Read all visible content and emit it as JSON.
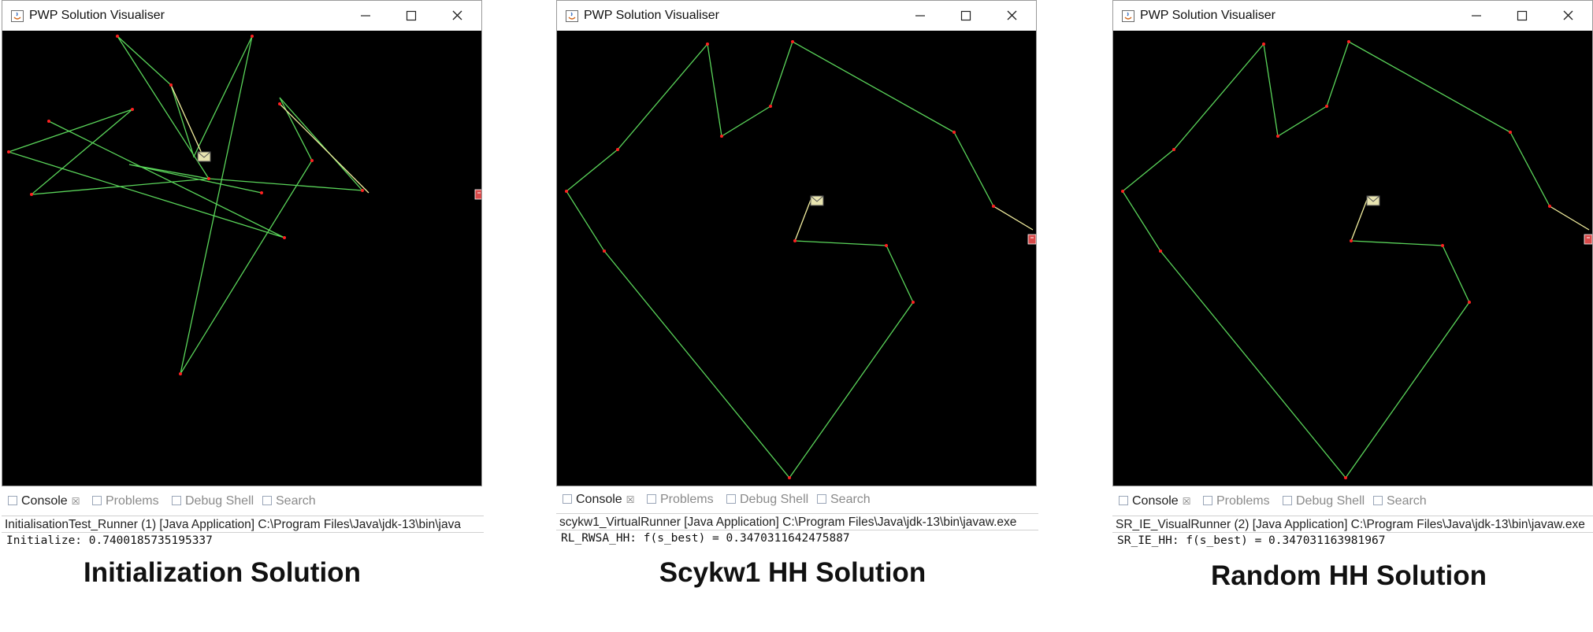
{
  "panels": [
    {
      "window_title": "PWP Solution Visualiser",
      "tabs": [
        {
          "label": "Console",
          "active": true,
          "closable": true,
          "icon": "console-icon"
        },
        {
          "label": "Problems",
          "icon": "problems-icon"
        },
        {
          "label": "Debug Shell",
          "icon": "debug-shell-icon"
        },
        {
          "label": "Search",
          "icon": "search-icon"
        }
      ],
      "launch_config": "InitialisationTest_Runner (1) [Java Application] C:\\Program Files\\Java\\jdk-13\\bin\\java",
      "output": "Initialize: 0.7400185735195337",
      "caption": "Initialization Solution",
      "route": {
        "colors": {
          "path": "#5ad55a",
          "delivery_leg": "#f4f0a0",
          "node": "#ff2020",
          "background": "#000000"
        }
      }
    },
    {
      "window_title": "PWP Solution Visualiser",
      "tabs": [
        {
          "label": "Console",
          "active": true,
          "closable": true,
          "icon": "console-icon"
        },
        {
          "label": "Problems",
          "icon": "problems-icon"
        },
        {
          "label": "Debug Shell",
          "icon": "debug-shell-icon"
        },
        {
          "label": "Search",
          "icon": "search-icon"
        }
      ],
      "launch_config": "scykw1_VirtualRunner [Java Application] C:\\Program Files\\Java\\jdk-13\\bin\\javaw.exe",
      "output": "RL_RWSA_HH: f(s_best) = 0.3470311642475887",
      "caption": "Scykw1 HH Solution",
      "route": {
        "colors": {
          "path": "#5ad55a",
          "delivery_leg": "#f4f0a0",
          "node": "#ff2020",
          "background": "#000000"
        }
      }
    },
    {
      "window_title": "PWP Solution Visualiser",
      "tabs": [
        {
          "label": "Console",
          "active": true,
          "closable": true,
          "icon": "console-icon"
        },
        {
          "label": "Problems",
          "icon": "problems-icon"
        },
        {
          "label": "Debug Shell",
          "icon": "debug-shell-icon"
        },
        {
          "label": "Search",
          "icon": "search-icon"
        }
      ],
      "launch_config": "SR_IE_VisualRunner (2) [Java Application] C:\\Program Files\\Java\\jdk-13\\bin\\javaw.exe",
      "output": "SR_IE_HH: f(s_best) = 0.347031163981967",
      "caption": "Random HH Solution",
      "route": {
        "colors": {
          "path": "#5ad55a",
          "delivery_leg": "#f4f0a0",
          "node": "#ff2020",
          "background": "#000000"
        }
      }
    }
  ]
}
